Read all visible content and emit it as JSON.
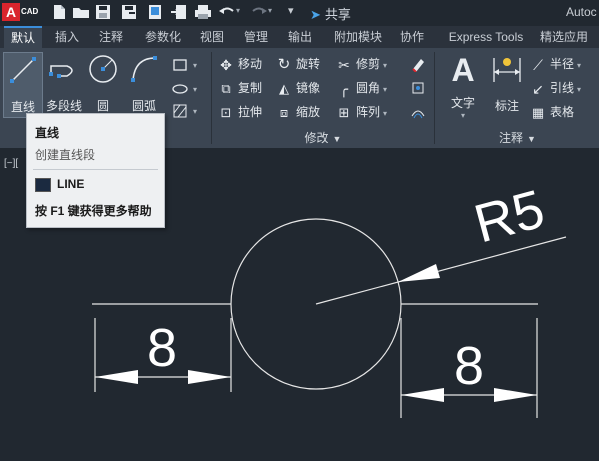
{
  "app": {
    "logo_letter": "A",
    "logo_text": "CAD",
    "title": "Autoc",
    "share_label": "共享"
  },
  "tabs": [
    "默认",
    "插入",
    "注释",
    "参数化",
    "视图",
    "管理",
    "输出",
    "附加模块",
    "协作",
    "Express Tools",
    "精选应用"
  ],
  "draw_panel": {
    "line": "直线",
    "polyline": "多段线",
    "circle": "圆",
    "arc": "圆弧"
  },
  "modify_panel": {
    "title": "修改",
    "move": "移动",
    "rotate": "旋转",
    "trim": "修剪",
    "copy": "复制",
    "mirror": "镜像",
    "fillet": "圆角",
    "stretch": "拉伸",
    "scale": "缩放",
    "array": "阵列"
  },
  "annotation_panel": {
    "title": "注释",
    "text": "文字",
    "dimension": "标注",
    "radius": "半径",
    "leader": "引线",
    "table": "表格"
  },
  "viewport_label": "[−][",
  "tooltip": {
    "title": "直线",
    "description": "创建直线段",
    "command": "LINE",
    "help": "按 F1 键获得更多帮助"
  },
  "drawing": {
    "dim_left": "8",
    "dim_right": "8",
    "radius_label": "R5"
  },
  "colors": {
    "accent": "#3b8edb",
    "logo": "#d9252d",
    "canvas": "#212830",
    "ribbon": "#3b4552"
  }
}
